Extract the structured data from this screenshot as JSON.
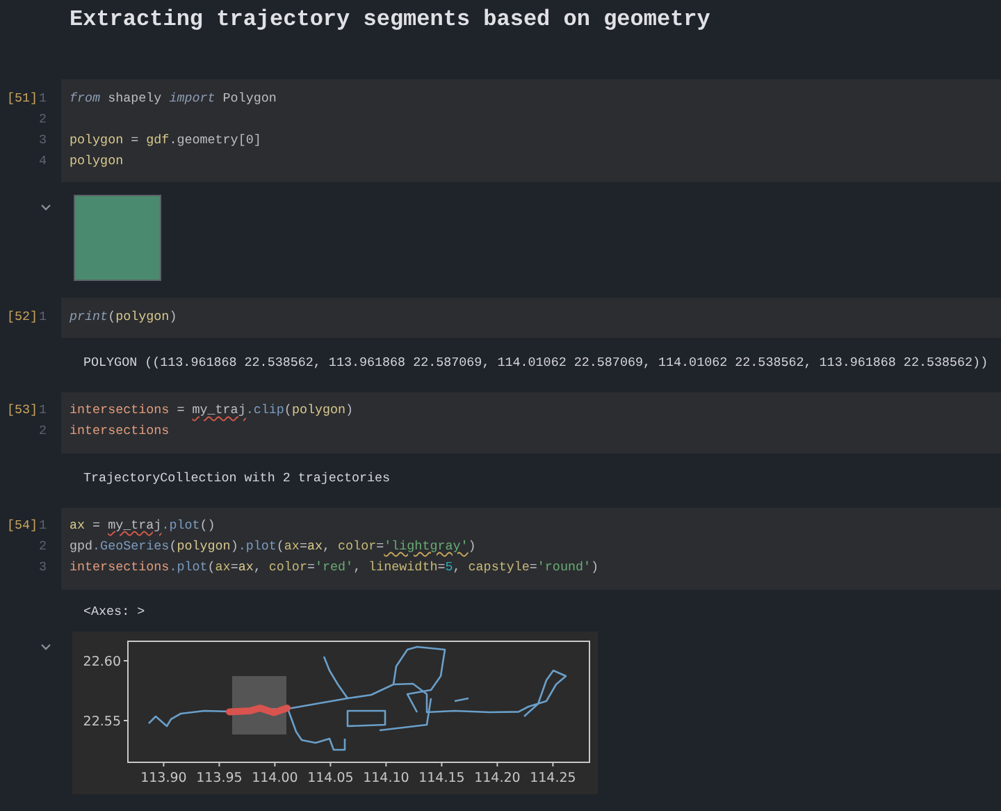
{
  "title": "Extracting trajectory segments based on geometry",
  "cells": [
    {
      "prompt": "[51]",
      "lines": [
        {
          "number": "1",
          "tokens": [
            {
              "text": "from",
              "kind": "keyword"
            },
            {
              "text": " shapely ",
              "kind": "plain"
            },
            {
              "text": "import",
              "kind": "keyword"
            },
            {
              "text": " Polygon",
              "kind": "plain"
            }
          ]
        },
        {
          "number": "2"
        },
        {
          "number": "3",
          "tokens": [
            {
              "text": "polygon",
              "kind": "var"
            },
            {
              "text": " = ",
              "kind": "plain"
            },
            {
              "text": "gdf",
              "kind": "var"
            },
            {
              "text": ".geometry[0]",
              "kind": "plain"
            }
          ]
        },
        {
          "number": "4",
          "tokens": [
            {
              "text": "polygon",
              "kind": "var"
            }
          ]
        }
      ],
      "outputs": [
        {
          "kind": "shape",
          "expanded": true
        }
      ]
    },
    {
      "prompt": "[52]",
      "lines": [
        {
          "number": "1",
          "tokens": [
            {
              "text": "print",
              "kind": "keyword"
            },
            {
              "text": "(",
              "kind": "plain"
            },
            {
              "text": "polygon",
              "kind": "var"
            },
            {
              "text": ")",
              "kind": "plain"
            }
          ]
        }
      ],
      "outputs": [
        {
          "kind": "text",
          "text": "POLYGON ((113.961868 22.538562, 113.961868 22.587069, 114.01062 22.587069, 114.01062 22.538562, 113.961868 22.538562))"
        }
      ]
    },
    {
      "prompt": "[53]",
      "lines": [
        {
          "number": "1",
          "tokens": [
            {
              "text": "intersections",
              "kind": "var2"
            },
            {
              "text": " = ",
              "kind": "plain"
            },
            {
              "text": "my_traj",
              "kind": "typo"
            },
            {
              "text": ".clip",
              "kind": "method"
            },
            {
              "text": "(",
              "kind": "plain"
            },
            {
              "text": "polygon",
              "kind": "var"
            },
            {
              "text": ")",
              "kind": "plain"
            }
          ]
        },
        {
          "number": "2",
          "tokens": [
            {
              "text": "intersections",
              "kind": "var2"
            }
          ]
        }
      ],
      "outputs": [
        {
          "kind": "text",
          "text": "TrajectoryCollection with 2 trajectories"
        }
      ]
    },
    {
      "prompt": "[54]",
      "lines": [
        {
          "number": "1",
          "tokens": [
            {
              "text": "ax",
              "kind": "var"
            },
            {
              "text": " = ",
              "kind": "plain"
            },
            {
              "text": "my_traj",
              "kind": "typo"
            },
            {
              "text": ".plot",
              "kind": "method"
            },
            {
              "text": "()",
              "kind": "plain"
            }
          ]
        },
        {
          "number": "2",
          "tokens": [
            {
              "text": "gpd",
              "kind": "plain"
            },
            {
              "text": ".GeoSeries",
              "kind": "method"
            },
            {
              "text": "(",
              "kind": "plain"
            },
            {
              "text": "polygon",
              "kind": "var"
            },
            {
              "text": ")",
              "kind": "plain"
            },
            {
              "text": ".plot",
              "kind": "method"
            },
            {
              "text": "(",
              "kind": "plain"
            },
            {
              "text": "ax",
              "kind": "param"
            },
            {
              "text": "=",
              "kind": "plain"
            },
            {
              "text": "ax",
              "kind": "var"
            },
            {
              "text": ", ",
              "kind": "plain"
            },
            {
              "text": "color",
              "kind": "param"
            },
            {
              "text": "=",
              "kind": "plain"
            },
            {
              "text": "'lightgray'",
              "kind": "string_typo"
            },
            {
              "text": ")",
              "kind": "plain"
            }
          ]
        },
        {
          "number": "3",
          "tokens": [
            {
              "text": "intersections",
              "kind": "var2"
            },
            {
              "text": ".plot",
              "kind": "method"
            },
            {
              "text": "(",
              "kind": "plain"
            },
            {
              "text": "ax",
              "kind": "param"
            },
            {
              "text": "=",
              "kind": "plain"
            },
            {
              "text": "ax",
              "kind": "var"
            },
            {
              "text": ", ",
              "kind": "plain"
            },
            {
              "text": "color",
              "kind": "param"
            },
            {
              "text": "=",
              "kind": "plain"
            },
            {
              "text": "'red'",
              "kind": "string"
            },
            {
              "text": ", ",
              "kind": "plain"
            },
            {
              "text": "linewidth",
              "kind": "param"
            },
            {
              "text": "=",
              "kind": "plain"
            },
            {
              "text": "5",
              "kind": "number"
            },
            {
              "text": ", ",
              "kind": "plain"
            },
            {
              "text": "capstyle",
              "kind": "param"
            },
            {
              "text": "=",
              "kind": "plain"
            },
            {
              "text": "'round'",
              "kind": "string"
            },
            {
              "text": ")",
              "kind": "plain"
            }
          ]
        }
      ],
      "outputs": [
        {
          "kind": "text",
          "text": "<Axes: >"
        },
        {
          "kind": "plot",
          "expanded": true,
          "xticks": [
            "113.90",
            "113.95",
            "114.00",
            "114.05",
            "114.10",
            "114.15",
            "114.20",
            "114.25"
          ],
          "yticks": [
            "22.60",
            "22.55"
          ]
        }
      ]
    }
  ]
}
